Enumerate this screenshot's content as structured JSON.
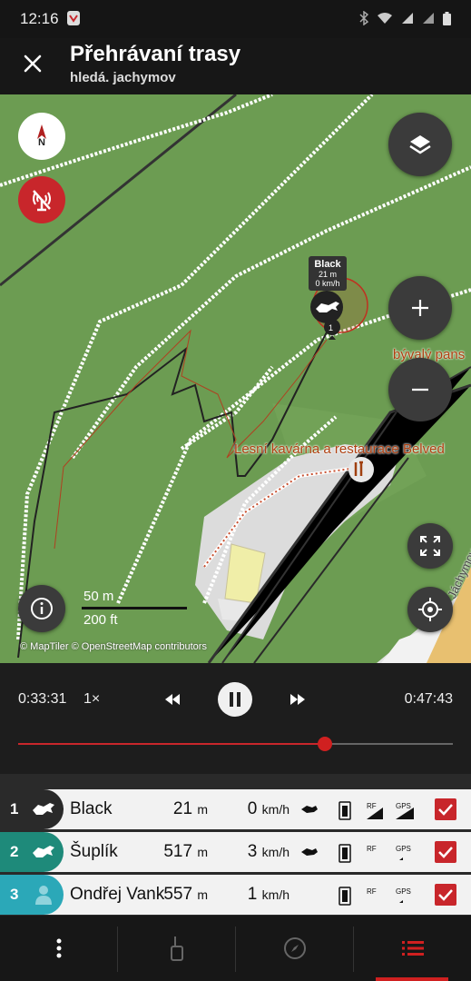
{
  "status_bar": {
    "time": "12:16"
  },
  "app_bar": {
    "title": "Přehrávaní trasy",
    "subtitle": "hledá. jachymov"
  },
  "map": {
    "compass_label": "N",
    "poi_labels": [
      "bývalý pans",
      "Lesní kavárna a restaurace Belved"
    ],
    "street_label": "Jáchymov",
    "scale_metric": "50 m",
    "scale_imperial": "200 ft",
    "attribution": "© MapTiler © OpenStreetMap contributors",
    "dog_tag": {
      "name": "Black",
      "distance": "21 m",
      "speed": "0 km/h"
    },
    "marker_number": "1"
  },
  "playback": {
    "elapsed": "0:33:31",
    "speed": "1×",
    "total": "0:47:43",
    "progress_percent": 70.5
  },
  "tracks": [
    {
      "number": "1",
      "name": "Black",
      "distance": "21",
      "distance_unit": "m",
      "speed": "0",
      "speed_unit": "km/h",
      "color": "#2a2a2a",
      "icon": "dog-icon",
      "checked": true
    },
    {
      "number": "2",
      "name": "Šuplík",
      "distance": "517",
      "distance_unit": "m",
      "speed": "3",
      "speed_unit": "km/h",
      "color": "#1e8a7a",
      "icon": "dog-icon",
      "checked": true
    },
    {
      "number": "3",
      "name": "Ondřej Vank",
      "distance": "557",
      "distance_unit": "m",
      "speed": "1",
      "speed_unit": "km/h",
      "color": "#2ba8b8",
      "icon": "person-icon",
      "checked": true
    }
  ],
  "status_labels": {
    "rf": "RF",
    "gps": "GPS"
  },
  "colors": {
    "accent": "#c8262b",
    "map_green": "#6b9b52"
  }
}
